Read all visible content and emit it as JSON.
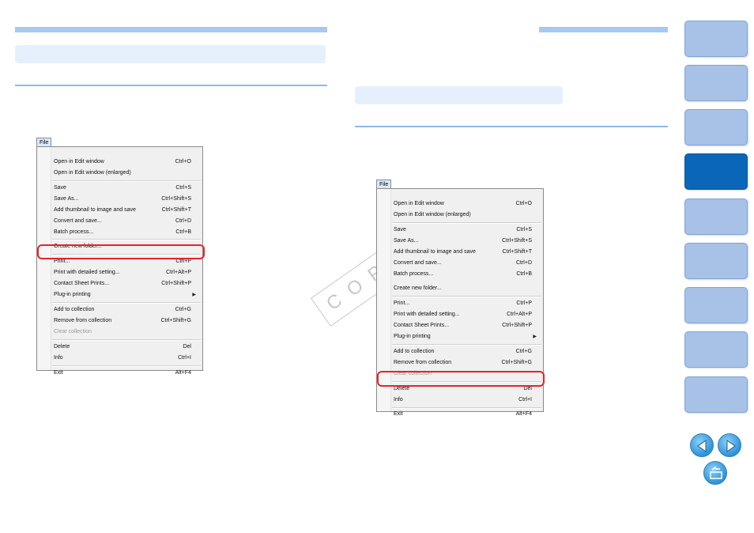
{
  "colors": {
    "accent_bar": "#a9c8f0",
    "pill": "#e6f0fc",
    "highlight": "#e3242b",
    "tab": "#a7c2e6",
    "tab_active": "#0a66b8"
  },
  "watermark": "COPY",
  "menu_left": {
    "title": "File",
    "items": [
      {
        "label": "Open in Edit window",
        "shortcut": "Ctrl+O"
      },
      {
        "label": "Open in Edit window (enlarged)",
        "shortcut": ""
      },
      {
        "label": "Save",
        "shortcut": "Ctrl+S"
      },
      {
        "label": "Save As...",
        "shortcut": "Ctrl+Shift+S"
      },
      {
        "label": "Add thumbnail to image and save",
        "shortcut": "Ctrl+Shift+T"
      },
      {
        "label": "Convert and save...",
        "shortcut": "Ctrl+D"
      },
      {
        "label": "Batch process...",
        "shortcut": "Ctrl+B"
      },
      {
        "label": "Create new folder...",
        "shortcut": ""
      },
      {
        "label": "Print...",
        "shortcut": "Ctrl+P"
      },
      {
        "label": "Print with detailed setting...",
        "shortcut": "Ctrl+Alt+P"
      },
      {
        "label": "Contact Sheet Prints...",
        "shortcut": "Ctrl+Shift+P"
      },
      {
        "label": "Plug-in printing",
        "shortcut": ""
      },
      {
        "label": "Add to collection",
        "shortcut": "Ctrl+G"
      },
      {
        "label": "Remove from collection",
        "shortcut": "Ctrl+Shift+G"
      },
      {
        "label": "Clear collection",
        "shortcut": ""
      },
      {
        "label": "Delete",
        "shortcut": "Del"
      },
      {
        "label": "Info",
        "shortcut": "Ctrl+I"
      },
      {
        "label": "Exit",
        "shortcut": "Alt+F4"
      }
    ]
  },
  "menu_right": {
    "title": "File",
    "items": [
      {
        "label": "Open in Edit window",
        "shortcut": "Ctrl+O"
      },
      {
        "label": "Open in Edit window (enlarged)",
        "shortcut": ""
      },
      {
        "label": "Save",
        "shortcut": "Ctrl+S"
      },
      {
        "label": "Save As...",
        "shortcut": "Ctrl+Shift+S"
      },
      {
        "label": "Add thumbnail to image and save",
        "shortcut": "Ctrl+Shift+T"
      },
      {
        "label": "Convert and save...",
        "shortcut": "Ctrl+D"
      },
      {
        "label": "Batch process...",
        "shortcut": "Ctrl+B"
      },
      {
        "label": "Create new folder...",
        "shortcut": ""
      },
      {
        "label": "Print...",
        "shortcut": "Ctrl+P"
      },
      {
        "label": "Print with detailed setting...",
        "shortcut": "Ctrl+Alt+P"
      },
      {
        "label": "Contact Sheet Prints...",
        "shortcut": "Ctrl+Shift+P"
      },
      {
        "label": "Plug-in printing",
        "shortcut": ""
      },
      {
        "label": "Add to collection",
        "shortcut": "Ctrl+G"
      },
      {
        "label": "Remove from collection",
        "shortcut": "Ctrl+Shift+G"
      },
      {
        "label": "Clear collection",
        "shortcut": ""
      },
      {
        "label": "Delete",
        "shortcut": "Del"
      },
      {
        "label": "Info",
        "shortcut": "Ctrl+I"
      },
      {
        "label": "Exit",
        "shortcut": "Alt+F4"
      }
    ]
  },
  "nav": {
    "prev_icon": "arrow-left-icon",
    "next_icon": "arrow-right-icon",
    "return_icon": "return-icon"
  }
}
